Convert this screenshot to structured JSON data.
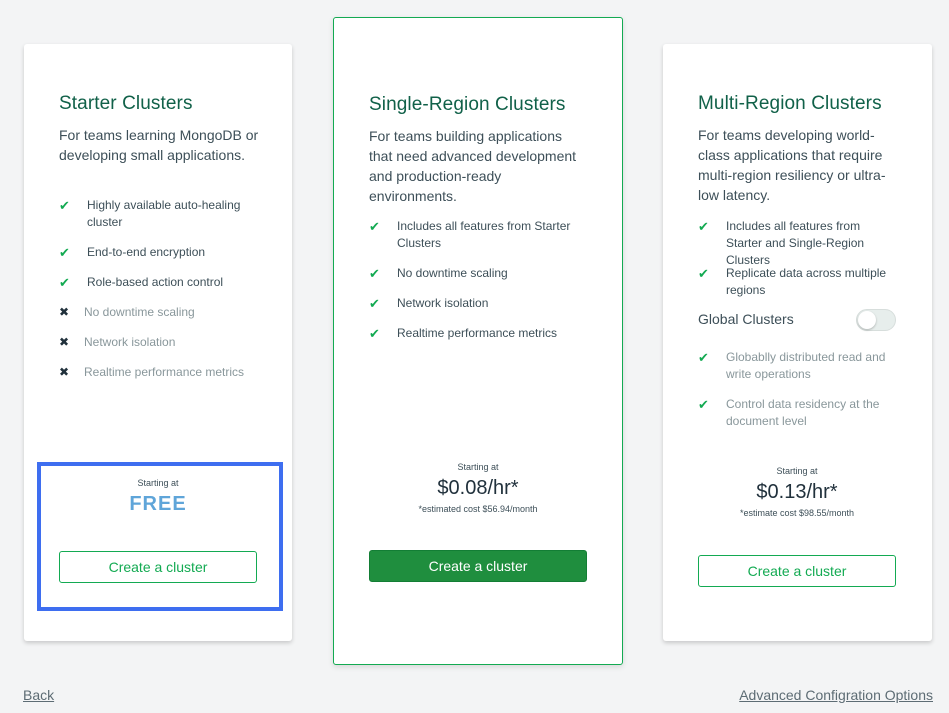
{
  "colors": {
    "accent_green": "#13aa52",
    "primary_button": "#1f8e3e",
    "title_green": "#116149",
    "free_blue": "#5fa5d9",
    "highlight_blue": "#3e6ef0",
    "background": "#f3f4f5"
  },
  "starter": {
    "title": "Starter Clusters",
    "desc": "For teams learning MongoDB or developing small applications.",
    "features": [
      {
        "label": "Highly available auto-healing cluster",
        "included": true,
        "icon": "check-icon"
      },
      {
        "label": "End-to-end encryption",
        "included": true,
        "icon": "check-icon"
      },
      {
        "label": "Role-based action control",
        "included": true,
        "icon": "check-icon"
      },
      {
        "label": "No downtime scaling",
        "included": false,
        "icon": "x-icon"
      },
      {
        "label": "Network isolation",
        "included": false,
        "icon": "x-icon"
      },
      {
        "label": "Realtime performance metrics",
        "included": false,
        "icon": "x-icon"
      }
    ],
    "starting_at": "Starting at",
    "price": "FREE",
    "button": "Create a cluster"
  },
  "single": {
    "title": "Single-Region Clusters",
    "desc": "For teams building applications that need advanced development and production-ready environments.",
    "features": [
      {
        "label": "Includes all features from Starter Clusters",
        "icon": "check-icon"
      },
      {
        "label": "No downtime scaling",
        "icon": "check-icon"
      },
      {
        "label": "Network isolation",
        "icon": "check-icon"
      },
      {
        "label": "Realtime performance metrics",
        "icon": "check-icon"
      }
    ],
    "starting_at": "Starting at",
    "price": "$0.08/hr*",
    "estimate": "*estimated cost $56.94/month",
    "button": "Create a cluster"
  },
  "multi": {
    "title": "Multi-Region Clusters",
    "desc": "For teams developing world-class applications that require multi-region resiliency or ultra-low latency.",
    "features": [
      {
        "label": "Includes all features from Starter and Single-Region Clusters",
        "icon": "check-icon"
      },
      {
        "label": "Replicate data across multiple regions",
        "icon": "check-icon"
      }
    ],
    "toggle_label": "Global Clusters",
    "toggle_on": false,
    "global_features": [
      {
        "label": "Globablly distributed read and write operations",
        "icon": "check-icon"
      },
      {
        "label": "Control data residency at the document level",
        "icon": "check-icon"
      }
    ],
    "starting_at": "Starting at",
    "price": "$0.13/hr*",
    "estimate": "*estimate cost $98.55/month",
    "button": "Create a cluster"
  },
  "footer": {
    "back": "Back",
    "advanced": "Advanced Configration Options"
  }
}
